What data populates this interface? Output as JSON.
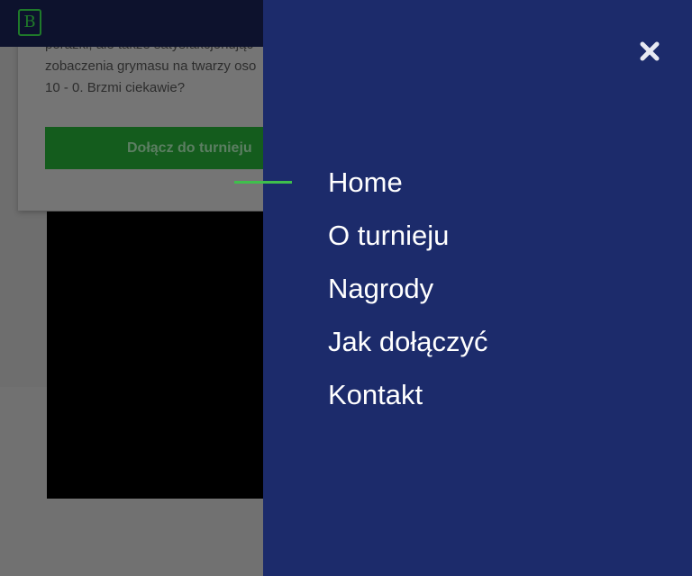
{
  "page": {
    "colors": {
      "nav_panel": "#1c2b6b",
      "active_indicator": "#3fbf4c",
      "header": "#0d122d",
      "join_button": "#145c1d"
    }
  },
  "header": {
    "logo_text": "B"
  },
  "card": {
    "text_lines": [
      "porażki, ale także satysfakcjonując",
      "zobaczenia grymasu na twarzy oso",
      "10 - 0. Brzmi ciekawie?"
    ],
    "join_button_label": "Dołącz do turnieju"
  },
  "nav": {
    "close_icon": "close-icon",
    "active_index": 0,
    "items": [
      {
        "label": "Home"
      },
      {
        "label": "O turnieju"
      },
      {
        "label": "Nagrody"
      },
      {
        "label": "Jak dołączyć"
      },
      {
        "label": "Kontakt"
      }
    ]
  }
}
